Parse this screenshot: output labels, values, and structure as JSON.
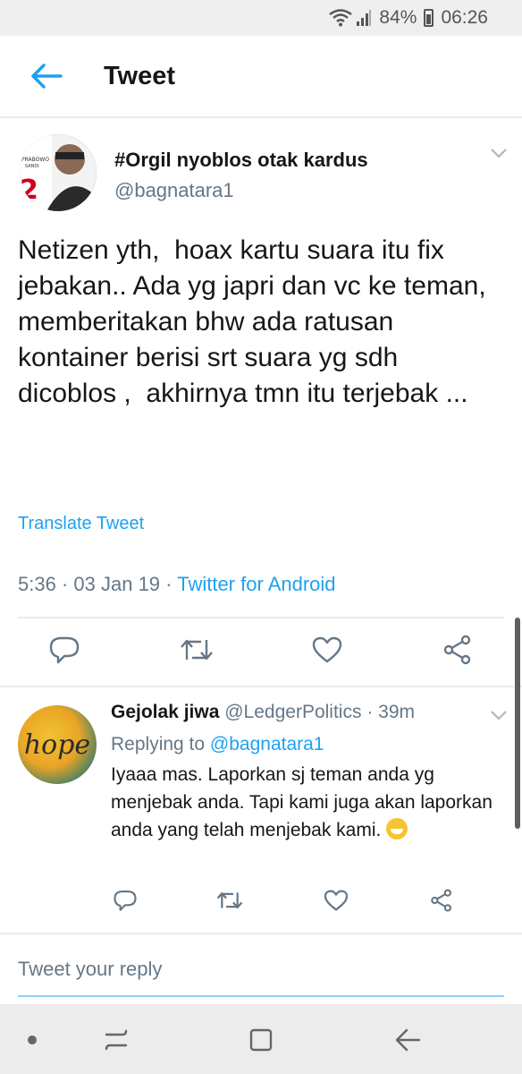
{
  "status_bar": {
    "battery": "84%",
    "time": "06:26"
  },
  "app_bar": {
    "title": "Tweet"
  },
  "tweet": {
    "author_name": "#Orgil nyoblos otak kardus",
    "author_handle": "@bagnatara1",
    "text": "Netizen yth,  hoax kartu suara itu fix jebakan.. Ada yg japri dan vc ke teman, memberitakan bhw ada ratusan kontainer berisi srt suara yg sdh dicoblos ,  akhirnya tmn itu terjebak ...",
    "translate_label": "Translate Tweet",
    "time": "5:36",
    "date": "03 Jan 19",
    "source": "Twitter for Android",
    "avatar_text_top": "PRABOWO",
    "avatar_text_sub": "SANDI",
    "avatar_number": "2"
  },
  "reply": {
    "author_name": "Gejolak jiwa",
    "author_handle": "@LedgerPolitics",
    "age": "39m",
    "replying_to_label": "Replying to",
    "replying_to_handle": "@bagnatara1",
    "text": "Iyaaa mas. Laporkan sj teman anda yg menjebak anda. Tapi kami juga akan laporkan anda yang telah menjebak kami.",
    "avatar_text": "hope"
  },
  "compose": {
    "placeholder": "Tweet your reply"
  },
  "colors": {
    "accent": "#1da1f2",
    "secondary_text": "#657786",
    "divider": "#e6ecf0"
  },
  "icons": [
    "wifi-icon",
    "signal-icon",
    "battery-icon",
    "back-arrow-icon",
    "chevron-down-icon",
    "reply-icon",
    "retweet-icon",
    "like-icon",
    "share-icon",
    "recents-icon",
    "home-icon",
    "nav-back-icon"
  ]
}
